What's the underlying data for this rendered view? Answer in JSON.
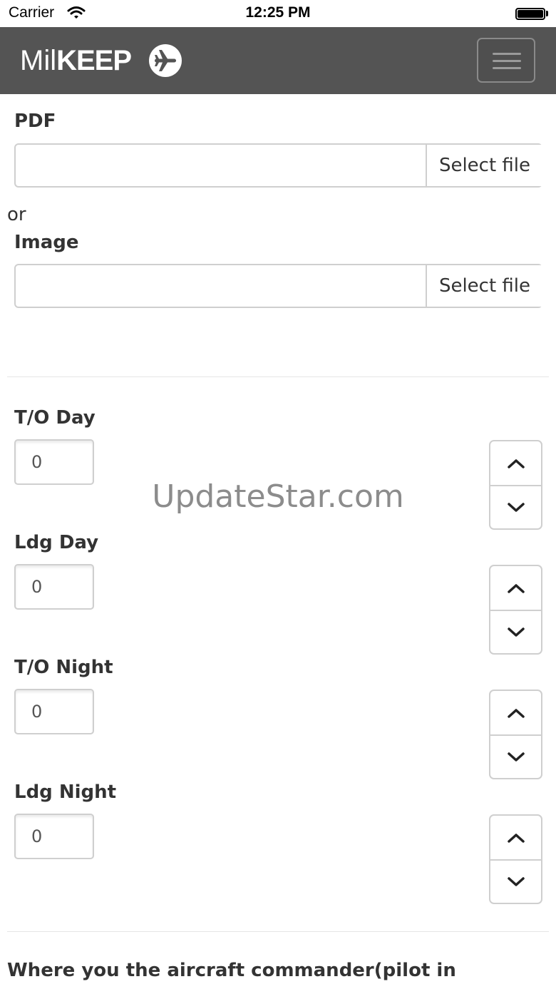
{
  "status_bar": {
    "carrier": "Carrier",
    "time": "12:25 PM"
  },
  "navbar": {
    "logo_mil": "Mil",
    "logo_keep": "KEEP",
    "logo_icon": "airplane-icon",
    "menu_icon": "hamburger-icon",
    "bg_color": "#545454"
  },
  "form": {
    "pdf": {
      "label": "PDF",
      "value": "",
      "button": "Select file"
    },
    "or_text": "or",
    "image": {
      "label": "Image",
      "value": "",
      "button": "Select file"
    },
    "counters": [
      {
        "label": "T/O Day",
        "value": "0"
      },
      {
        "label": "Ldg Day",
        "value": "0"
      },
      {
        "label": "T/O Night",
        "value": "0"
      },
      {
        "label": "Ldg Night",
        "value": "0"
      }
    ],
    "question": "Where you the aircraft commander(pilot in"
  },
  "watermark": "UpdateStar.com"
}
